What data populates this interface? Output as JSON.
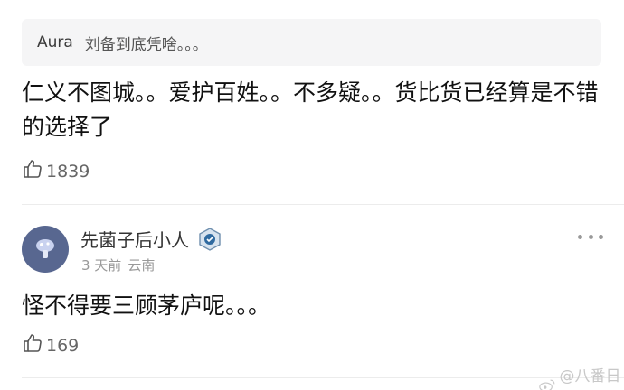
{
  "quoted_reply": {
    "author": "Aura",
    "text": "刘备到底凭啥。。。"
  },
  "comment1": {
    "text": "仁义不图城。。爱护百姓。。不多疑。。货比货已经算是不错的选择了",
    "likes": "1839"
  },
  "comment2": {
    "username": "先菌子后小人",
    "time": "3 天前",
    "location": "云南",
    "text": "怪不得要三顾茅庐呢。。。",
    "likes": "169"
  },
  "icons": {
    "like": "thumbs-up-icon",
    "more": "more-dots-icon",
    "badge": "user-badge-icon",
    "watermark": "weibo-logo-icon"
  },
  "watermark": {
    "text": "@八番日常"
  },
  "colors": {
    "quote_bg": "#f5f5f6",
    "avatar_bg": "#586790",
    "meta_text": "#999999"
  }
}
